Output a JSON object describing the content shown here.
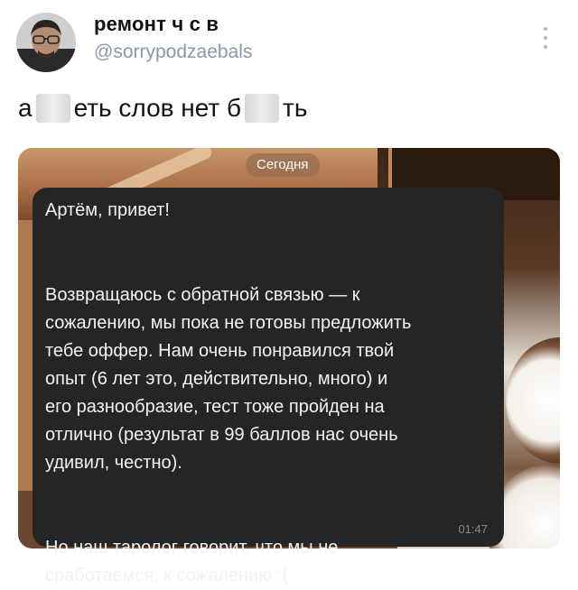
{
  "author": {
    "name": "ремонт ч с в",
    "handle": "@sorrypodzaebals"
  },
  "tweet": {
    "text_parts": [
      "а",
      "еть слов нет б",
      "ть"
    ]
  },
  "chat": {
    "date_label": "Сегодня",
    "message_lines": [
      "Артём, привет!",
      "",
      "Возвращаюсь с обратной связью — к",
      "сожалению, мы пока не готовы предложить",
      "тебе оффер. Нам очень понравился твой",
      "опыт (6 лет это, действительно, много) и",
      "его разнообразие, тест тоже пройден на",
      "отлично (результат в 99 баллов нас очень",
      "удивил, честно).",
      "",
      "Но наш таролог говорит, что мы не",
      "сработаемся, к сожалению :("
    ],
    "time": "01:47"
  },
  "icons": {
    "more": "more-vertical-icon"
  }
}
